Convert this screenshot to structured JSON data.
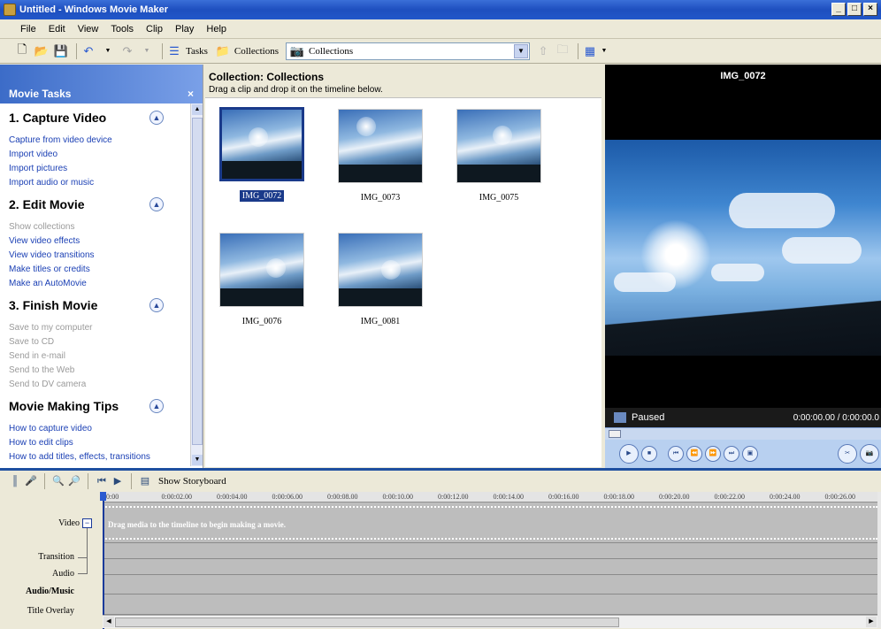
{
  "window": {
    "title": "Untitled - Windows Movie Maker",
    "buttons": [
      "_",
      "□",
      "×"
    ]
  },
  "menu": [
    "File",
    "Edit",
    "View",
    "Tools",
    "Clip",
    "Play",
    "Help"
  ],
  "toolbar": {
    "tasks_label": "Tasks",
    "collections_label": "Collections",
    "collection_select_value": "Collections"
  },
  "task_pane": {
    "header": "Movie Tasks",
    "close": "×",
    "sections": [
      {
        "title": "1. Capture Video",
        "links": [
          "Capture from video device",
          "Import video",
          "Import pictures",
          "Import audio or music"
        ],
        "disabled": [
          false,
          false,
          false,
          false
        ]
      },
      {
        "title": "2. Edit Movie",
        "links": [
          "Show collections",
          "View video effects",
          "View video transitions",
          "Make titles or credits",
          "Make an AutoMovie"
        ],
        "disabled": [
          true,
          false,
          false,
          false,
          false
        ]
      },
      {
        "title": "3. Finish Movie",
        "links": [
          "Save to my computer",
          "Save to CD",
          "Send in e-mail",
          "Send to the Web",
          "Send to DV camera"
        ],
        "disabled": [
          true,
          true,
          true,
          true,
          true
        ]
      },
      {
        "title": "Movie Making Tips",
        "links": [
          "How to capture video",
          "How to edit clips",
          "How to add titles, effects, transitions"
        ],
        "disabled": [
          false,
          false,
          false
        ]
      }
    ]
  },
  "collection": {
    "title": "Collection: Collections",
    "subtitle": "Drag a clip and drop it on the timeline below.",
    "clips": [
      {
        "name": "IMG_0072",
        "selected": true
      },
      {
        "name": "IMG_0073",
        "selected": false
      },
      {
        "name": "IMG_0075",
        "selected": false
      },
      {
        "name": "IMG_0076",
        "selected": false
      },
      {
        "name": "IMG_0081",
        "selected": false
      }
    ]
  },
  "monitor": {
    "title": "IMG_0072",
    "status": "Paused",
    "time": "0:00:00.00 / 0:00:00.0"
  },
  "timeline": {
    "show_storyboard": "Show Storyboard",
    "ruler": [
      "0:00",
      "0:00:02.00",
      "0:00:04.00",
      "0:00:06.00",
      "0:00:08.00",
      "0:00:10.00",
      "0:00:12.00",
      "0:00:14.00",
      "0:00:16.00",
      "0:00:18.00",
      "0:00:20.00",
      "0:00:22.00",
      "0:00:24.00",
      "0:00:26.00",
      "0:00"
    ],
    "video_message": "Drag media to the timeline to begin making a movie.",
    "tracks": {
      "video": "Video",
      "transition": "Transition",
      "audio": "Audio",
      "audio_music": "Audio/Music",
      "title_overlay": "Title Overlay"
    }
  },
  "colors": {
    "titlebar": "#1e4fbf",
    "link": "#1a3fb4",
    "selection": "#1a3a8a",
    "track": "#bdbdbd"
  }
}
